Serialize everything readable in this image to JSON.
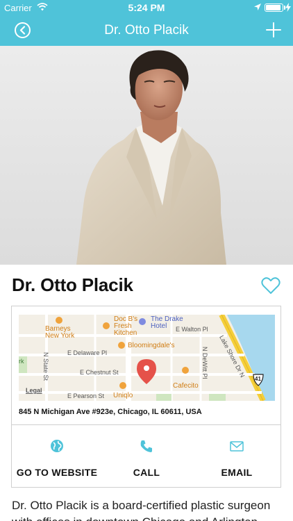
{
  "status": {
    "carrier": "Carrier",
    "time": "5:24 PM",
    "battery_level": 0.85
  },
  "nav": {
    "title": "Dr. Otto Placik",
    "back_icon": "back-circle-icon",
    "add_icon": "plus-icon"
  },
  "profile": {
    "name": "Dr. Otto Placik",
    "favorite_icon": "heart-outline-icon"
  },
  "map": {
    "labels": {
      "barneys": "Barneys\nNew York",
      "docbs": "Doc B's\nFresh\nKitchen",
      "drake": "The Drake\nHotel",
      "walton": "E Walton Pl",
      "lakeshore": "Lake Shore Dr N",
      "bloomingdales": "Bloomingdale's",
      "delaware": "E Delaware Pl",
      "dewitt": "N DeWitt Pl",
      "state": "N State St",
      "chestnut": "E Chestnut St",
      "park": "rk",
      "cafecito": "Cafecito",
      "legal": "Legal",
      "pearson": "E Pearson St",
      "uniqlo": "Uniqlo",
      "highway": "41"
    }
  },
  "address": "845 N Michigan Ave #923e, Chicago, IL 60611, USA",
  "actions": {
    "website": "GO TO WEBSITE",
    "call": "CALL",
    "email": "EMAIL"
  },
  "bio": "Dr. Otto Placik is a board-certified plastic surgeon with offices in downtown Chicago and Arlington",
  "colors": {
    "brand": "#4fc3d9",
    "water": "#a7d8ee",
    "road_yellow": "#f5cf3a"
  }
}
